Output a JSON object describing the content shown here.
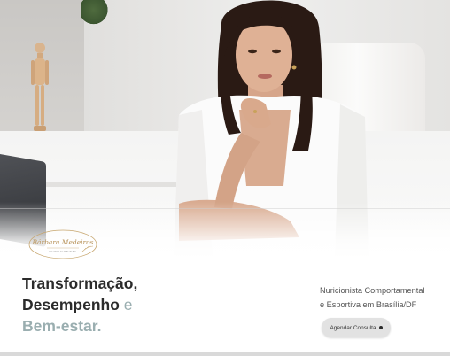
{
  "hero": {
    "image_alt": "Bárbara Medeiros nutricionista sentada em escritório claro"
  },
  "logo": {
    "script_name": "Bárbara Medeiros",
    "tagline": "NUTRICIONISTA"
  },
  "headline": {
    "line1": "Transformação,",
    "line2_main": "Desempenho",
    "line2_connector": " e",
    "line3": "Bem-estar."
  },
  "subtitle": {
    "line1": "Nuricionista Comportamental",
    "line2": "e Esportiva em Brasília/DF"
  },
  "cta": {
    "label": "Agendar Consulta"
  },
  "colors": {
    "headline": "#2b2b2b",
    "accent": "#9aaeb0",
    "button_bg": "#e2e2e2"
  }
}
